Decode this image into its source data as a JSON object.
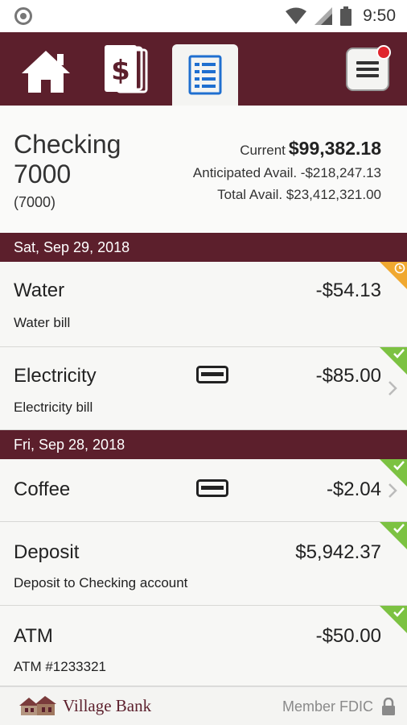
{
  "status_bar": {
    "time": "9:50"
  },
  "nav": {
    "tabs": [
      {
        "name": "home",
        "icon": "home-icon"
      },
      {
        "name": "transfers",
        "icon": "dollar-bill-icon"
      },
      {
        "name": "accounts",
        "icon": "register-icon",
        "active": true
      }
    ],
    "menu_icon": "menu-icon",
    "menu_has_notification": true
  },
  "account": {
    "name": "Checking 7000",
    "number": "(7000)",
    "current_label": "Current",
    "current_value": "$99,382.18",
    "anticipated": "Anticipated Avail. -$218,247.13",
    "total": "Total Avail. $23,412,321.00"
  },
  "groups": [
    {
      "date": "Sat, Sep 29, 2018"
    },
    {
      "date": "Fri, Sep 28, 2018"
    }
  ],
  "transactions": [
    {
      "title": "Water",
      "desc": "Water bill",
      "amount": "-$54.13",
      "status": "pending",
      "has_card": false,
      "has_chevron": false
    },
    {
      "title": "Electricity",
      "desc": "Electricity bill",
      "amount": "-$85.00",
      "status": "cleared",
      "has_card": true,
      "has_chevron": true
    },
    {
      "title": "Coffee",
      "desc": "",
      "amount": "-$2.04",
      "status": "cleared",
      "has_card": true,
      "has_chevron": true
    },
    {
      "title": "Deposit",
      "desc": "Deposit to Checking account",
      "amount": "$5,942.37",
      "status": "cleared",
      "has_card": false,
      "has_chevron": false
    },
    {
      "title": "ATM",
      "desc": "ATM #1233321",
      "amount": "-$50.00",
      "status": "cleared",
      "has_card": false,
      "has_chevron": false
    }
  ],
  "footer": {
    "bank_name": "Village Bank",
    "fdic": "Member FDIC"
  },
  "colors": {
    "brand": "#5c1f2c",
    "cleared": "#7cc242",
    "pending": "#f0a830",
    "active_icon": "#1f6fd0"
  }
}
